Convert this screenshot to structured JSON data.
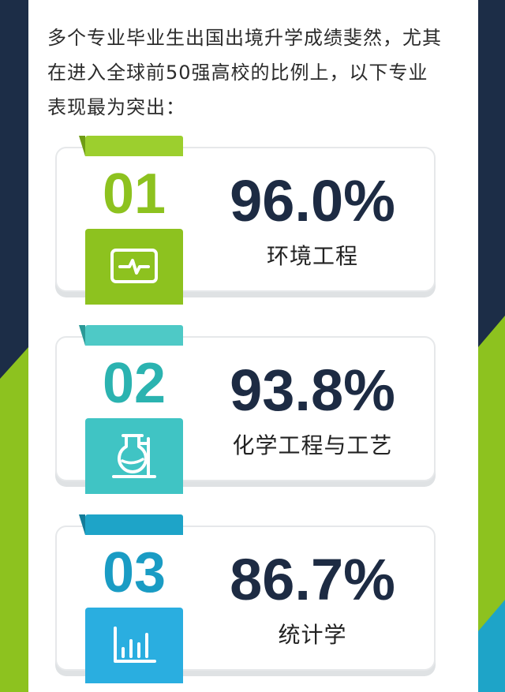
{
  "intro_text": "多个专业毕业生出国出境升学成绩斐然，尤其在进入全球前50强高校的比例上，以下专业表现最为突出：",
  "colors": {
    "background_navy": "#1c2d47",
    "accent_green": "#8dc21f",
    "accent_teal": "#3bbfbf",
    "accent_blue": "#2aa8d8",
    "percent_text": "#1d2b43"
  },
  "majors": [
    {
      "rank": "01",
      "percent": "96.0%",
      "name": "环境工程",
      "icon": "pulse-monitor-icon",
      "color": "#8dc21f",
      "tab_color": "#9ccf2e",
      "tab_dark": "#6f9c14",
      "num_color": "#8dc21f"
    },
    {
      "rank": "02",
      "percent": "93.8%",
      "name": "化学工程与工艺",
      "icon": "flask-icon",
      "color": "#40c4c4",
      "tab_color": "#4ec9c6",
      "tab_dark": "#2a9997",
      "num_color": "#2bb3b0"
    },
    {
      "rank": "03",
      "percent": "86.7%",
      "name": "统计学",
      "icon": "bar-chart-icon",
      "color": "#2aaee0",
      "tab_color": "#1ea4c8",
      "tab_dark": "#127c99",
      "num_color": "#1a9cc4"
    }
  ]
}
